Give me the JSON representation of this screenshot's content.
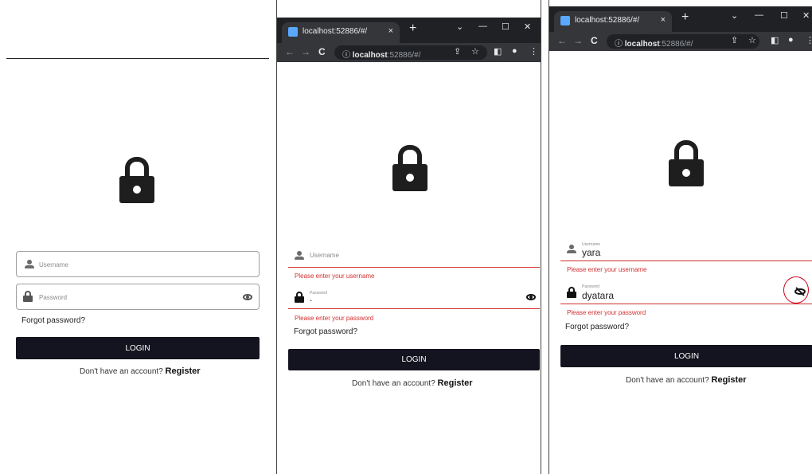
{
  "browser": {
    "tab_title": "localhost:52886/#/",
    "tab_close": "×",
    "new_tab": "+",
    "minimize": "—",
    "maximize": "☐",
    "close": "✕",
    "back": "←",
    "forward": "→",
    "reload": "C",
    "info": "ⓘ",
    "url_host": "localhost",
    "url_path": ":52886/#/",
    "share_icon": "⇪",
    "star_icon": "☆",
    "panel_icon": "◧",
    "profile_icon": "●",
    "menu_icon": "⋮"
  },
  "form": {
    "username_placeholder": "Username",
    "username_label": "Username",
    "password_placeholder": "Password",
    "password_label": "Password",
    "forgot": "Forgot password?",
    "login": "LOGIN",
    "no_account": "Don't have an account?",
    "register": "Register"
  },
  "screen2": {
    "username_error": "Please enter your username",
    "password_value": ".",
    "password_error": "Please enter your password"
  },
  "screen3": {
    "username_value": "yara",
    "password_value": "dyatara",
    "username_error": "Please enter your username",
    "password_error": "Please enter your password"
  },
  "colors": {
    "error": "#d32f2f",
    "button": "#141420",
    "annotation": "#d0021b"
  }
}
